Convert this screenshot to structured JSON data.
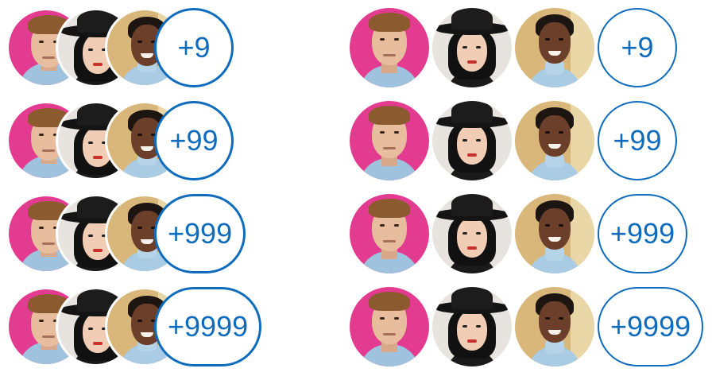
{
  "accent_color": "#0f6cbd",
  "avatar_groups": {
    "stacked": [
      {
        "overflow_label": "+9"
      },
      {
        "overflow_label": "+99"
      },
      {
        "overflow_label": "+999"
      },
      {
        "overflow_label": "+9999"
      }
    ],
    "spread": [
      {
        "overflow_label": "+9"
      },
      {
        "overflow_label": "+99"
      },
      {
        "overflow_label": "+999"
      },
      {
        "overflow_label": "+9999"
      }
    ]
  },
  "avatar_icons": [
    "man-on-pink-avatar",
    "woman-with-hat-avatar",
    "smiling-woman-avatar"
  ]
}
